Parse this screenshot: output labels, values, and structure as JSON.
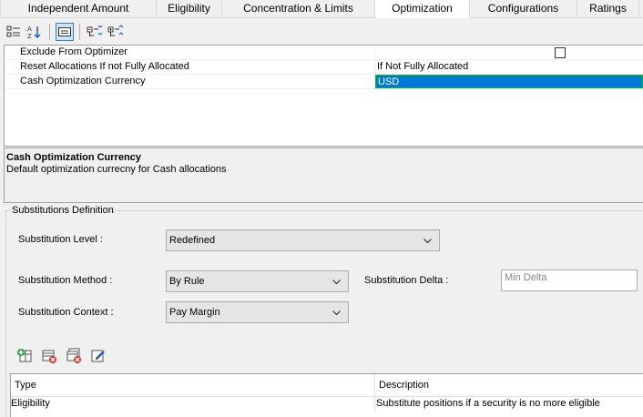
{
  "tabs": [
    {
      "label": "Independent Amount",
      "active": false
    },
    {
      "label": "Eligibility",
      "active": false
    },
    {
      "label": "Concentration & Limits",
      "active": false
    },
    {
      "label": "Optimization",
      "active": true
    },
    {
      "label": "Configurations",
      "active": false
    },
    {
      "label": "Ratings",
      "active": false
    }
  ],
  "toolbar": {
    "icons": [
      "categorized-view-icon",
      "sort-alphabetical-icon",
      "property-pages-icon",
      "expand-all-icon",
      "collapse-all-icon"
    ]
  },
  "properties": [
    {
      "name": "Exclude From Optimizer",
      "value": "",
      "type": "checkbox",
      "checked": false
    },
    {
      "name": "Reset Allocations If not Fully Allocated",
      "value": "If Not Fully Allocated",
      "type": "text"
    },
    {
      "name": "Cash Optimization Currency",
      "value": "USD",
      "type": "text",
      "selected": true
    }
  ],
  "description": {
    "title": "Cash Optimization Currency",
    "text": "Default optimization currecny for Cash allocations"
  },
  "substitutions": {
    "group_title": "Substitutions Definition",
    "level_label": "Substitution Level :",
    "level_value": "Redefined",
    "method_label": "Substitution Method :",
    "method_value": "By Rule",
    "delta_label": "Substitution Delta :",
    "delta_placeholder": "Min Delta",
    "context_label": "Substitution Context :",
    "context_value": "Pay Margin"
  },
  "table": {
    "columns": [
      "Type",
      "Description"
    ],
    "rows": [
      {
        "type": "Eligibility",
        "description": "Substitute positions if a security is no more eligible"
      }
    ]
  },
  "colors": {
    "selection": "#0078d7",
    "selection_border": "#00c000"
  }
}
